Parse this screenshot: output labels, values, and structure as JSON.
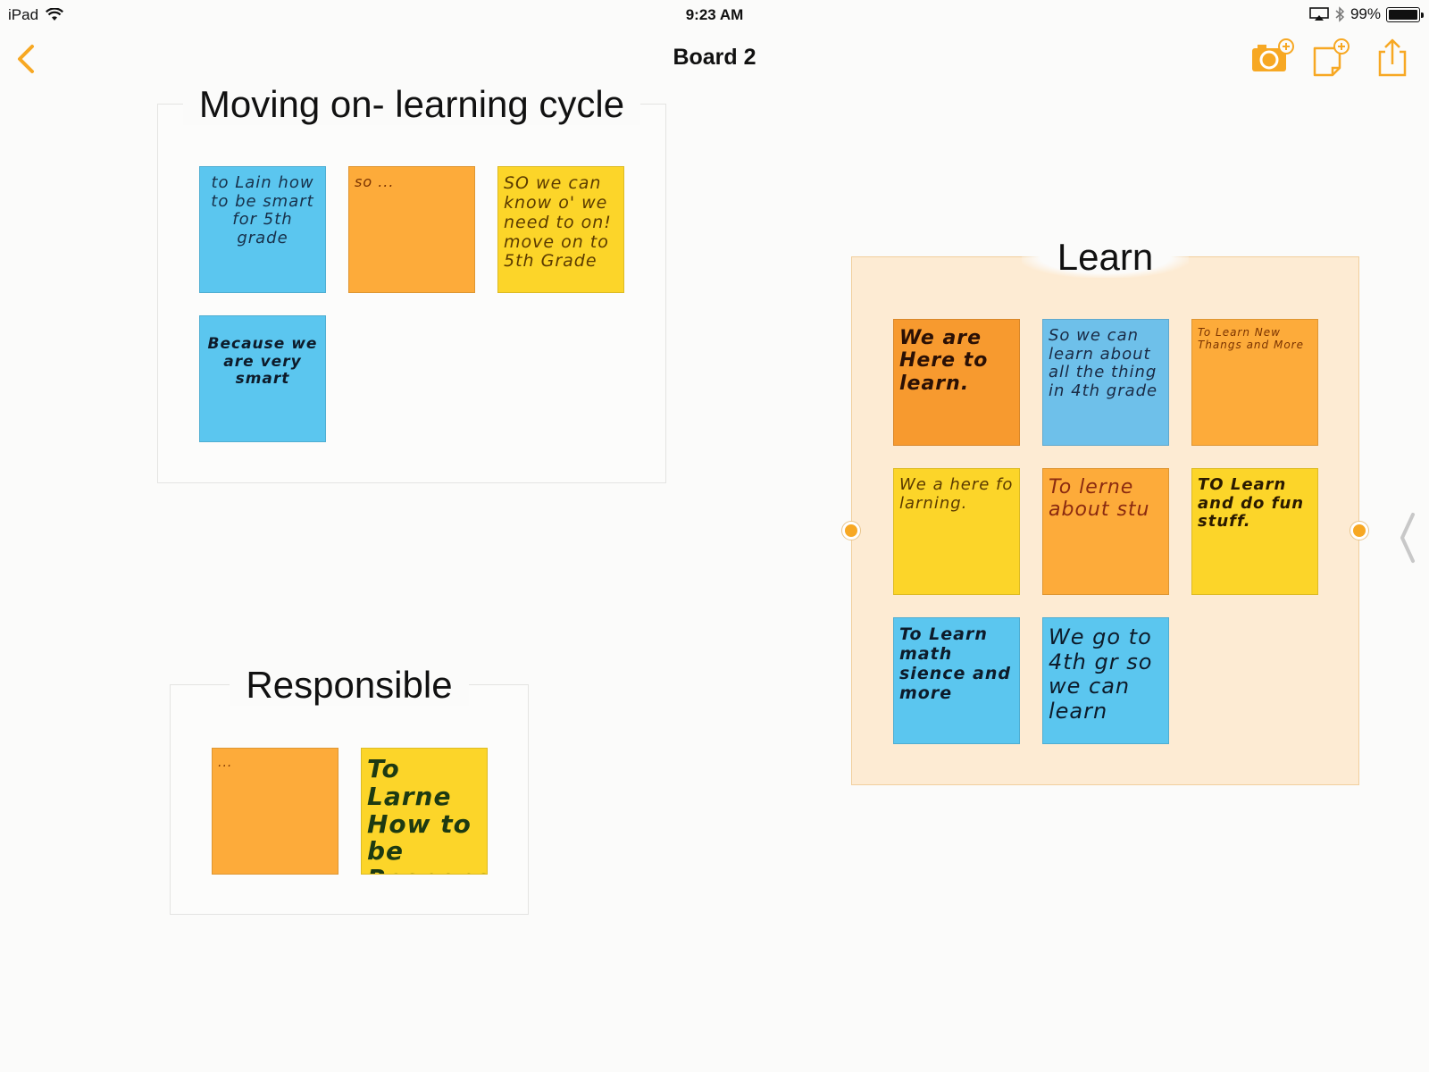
{
  "status_bar": {
    "device": "iPad",
    "time": "9:23 AM",
    "battery": "99%"
  },
  "nav": {
    "title": "Board 2"
  },
  "icons": {
    "back": "chevron-left-icon",
    "camera": "camera-add-icon",
    "note": "note-add-icon",
    "share": "share-icon",
    "accent_color": "#f7a823"
  },
  "sections": {
    "moving_on": {
      "title": "Moving on- learning cycle",
      "notes": [
        {
          "text": "to Lain how to be smart for 5th grade",
          "color": "blue"
        },
        {
          "text": "so ...",
          "color": "orange"
        },
        {
          "text": "SO we can know o' we need to on! move on to 5th Grade",
          "color": "yellow"
        },
        {
          "text": "Because we are very smart",
          "color": "blue"
        }
      ]
    },
    "responsible": {
      "title": "Responsible",
      "notes": [
        {
          "text": "...",
          "color": "orange"
        },
        {
          "text": "To Larne How to be Responsi",
          "color": "yellow"
        }
      ]
    },
    "learn": {
      "title": "Learn",
      "notes": [
        {
          "text": "We are Here to learn.",
          "color": "darkorange"
        },
        {
          "text": "So we can learn about all the thing in 4th grade",
          "color": "lightblue"
        },
        {
          "text": "To Learn New Thangs and More",
          "color": "orange"
        },
        {
          "text": "We a here fo larning.",
          "color": "yellow"
        },
        {
          "text": "To lerne about stu",
          "color": "orange"
        },
        {
          "text": "TO Learn and do fun stuff.",
          "color": "yellow"
        },
        {
          "text": "To Learn math sience and more",
          "color": "blue"
        },
        {
          "text": "We go to 4th gr so we can learn",
          "color": "blue"
        }
      ]
    }
  }
}
